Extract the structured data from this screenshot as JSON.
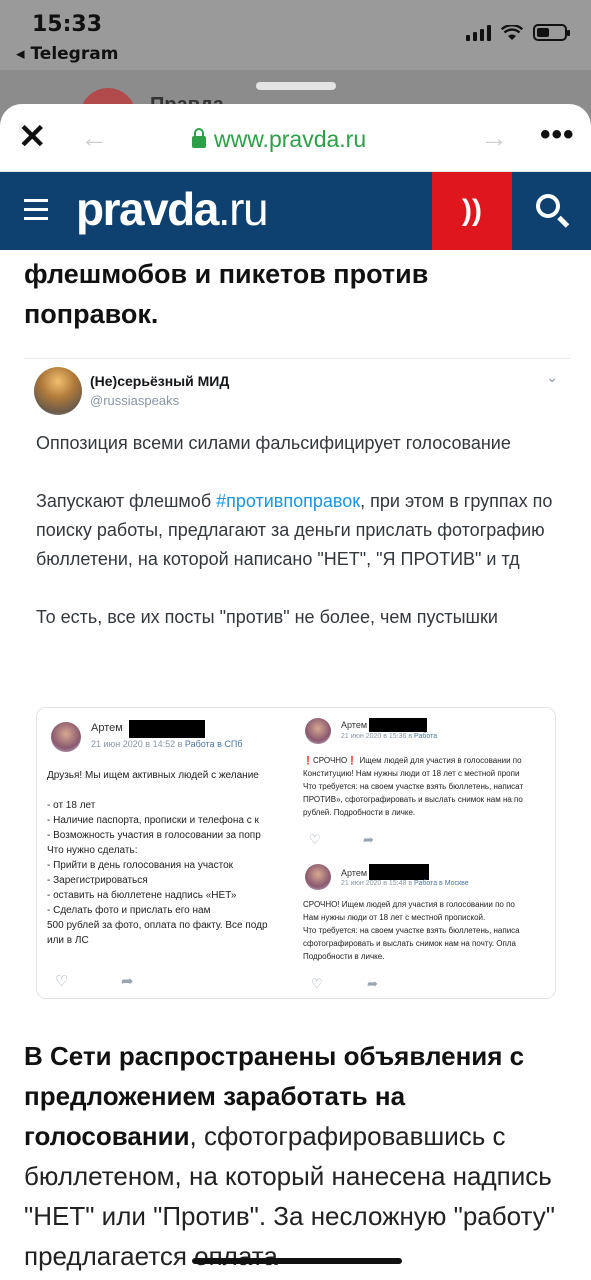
{
  "status": {
    "time": "15:33",
    "back_app": "◂ Telegram"
  },
  "behind": {
    "title": "Правда"
  },
  "browser": {
    "url": "www.pravda.ru",
    "close": "✕",
    "back": "←",
    "forward": "→",
    "more": "•••"
  },
  "site": {
    "logo_bold": "pravda",
    "logo_thin": ".ru",
    "radio": "))"
  },
  "article": {
    "heading_top": "флешмобов и пикетов против поправок.",
    "para_bold": "В Сети распространены объявления с предложением заработать на голосовании",
    "para_rest": ", сфотографировавшись с бюллетеном, на который нанесена надпись \"НЕТ\" или \"Против\". За несложную \"работу\" предлагается оплата"
  },
  "tweet": {
    "name": "(Не)серьёзный МИД",
    "handle": "@russiaspeaks",
    "chevron": "⌄",
    "text_1": "Оппозиция всеми силами фальсифицирует голосование\n\nЗапускают флешмоб ",
    "hashtag": "#противпоправок",
    "text_2": ", при этом в группах по поиску работы, предлагают за деньги прислать фотографию бюллетени, на которой написано \"НЕТ\", \"Я ПРОТИВ\" и тд\n\nТо есть, все их посты \"против\" не более, чем пустышки"
  },
  "screenshot": {
    "post1": {
      "name": "Артем",
      "date": "21 июн 2020 в 14:52 в ",
      "group": "Работа в СПб",
      "body": "Друзья! Мы ищем активных людей с желание\n\n- от 18 лет\n- Наличие паспорта, прописки и телефона с к\n- Возможность участия в голосовании за попр\nЧто нужно сделать:\n- Прийти в день голосования на участок\n- Зарегистрироваться\n- оставить на бюллетене надпись «НЕТ»\n- Сделать фото и прислать его нам\n500 рублей за фото, оплата по факту. Все подр\nили в ЛС"
    },
    "post2": {
      "name": "Артем",
      "date": "21 июн 2020 в 15:36 в ",
      "group": "Работа",
      "body": "❗СРОЧНО❗ Ищем людей для участия в голосовании по\nКонституцию! Нам нужны люди от 18 лет с местной пропи\nЧто требуется: на своем участке взять бюллетень, написат\nПРОТИВ», сфотографировать и выслать снимок нам на по\nрублей. Подробности в личке."
    },
    "post3": {
      "name": "Артем",
      "date": "21 июн 2020 в 15:48 в ",
      "group": "Работа в Москве",
      "body": "СРОЧНО! Ищем людей для участия в голосовании по по\nНам нужны люди от 18 лет с местной пропиской.\nЧто требуется: на своем участке взять бюллетень, написа\nсфотографировать и выслать снимок нам на почту. Опла\nПодробности в личке."
    },
    "heart_icon": "♡",
    "share_icon": "➦"
  }
}
